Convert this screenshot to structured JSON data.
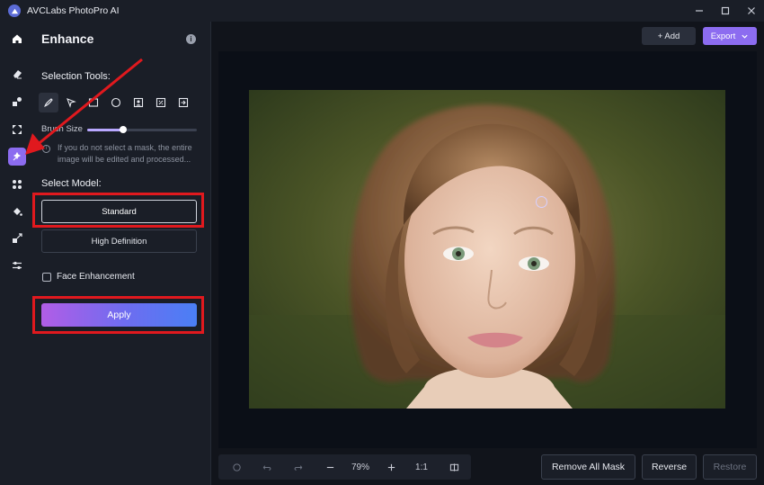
{
  "app": {
    "title": "AVCLabs PhotoPro AI",
    "window_controls": [
      "minimize",
      "maximize",
      "close"
    ]
  },
  "rail": {
    "items": [
      {
        "name": "home-icon"
      },
      {
        "name": "eraser-icon"
      },
      {
        "name": "replace-icon"
      },
      {
        "name": "scale-icon"
      },
      {
        "name": "enhance-icon",
        "active": true
      },
      {
        "name": "cutout-icon"
      },
      {
        "name": "fill-icon"
      },
      {
        "name": "resize-icon"
      },
      {
        "name": "adjust-icon"
      }
    ],
    "active_color": "#8c6cf0"
  },
  "panel": {
    "title": "Enhance",
    "selection_tools_label": "Selection Tools:",
    "tools": [
      "brush-icon",
      "lasso-icon",
      "rectangle-icon",
      "ellipse-icon",
      "portrait-icon",
      "auto-select-icon",
      "export-mask-icon"
    ],
    "brush_size_label": "Brush Size",
    "brush_size_fraction": 0.33,
    "note": "If you do not select a mask, the entire image will be edited and processed...",
    "select_model_label": "Select Model:",
    "models": [
      "Standard",
      "High Definition"
    ],
    "selected_model": "Standard",
    "face_enhancement_label": "Face Enhancement",
    "face_enhancement_checked": false,
    "apply_label": "Apply"
  },
  "toolbar": {
    "add_label": "+ Add",
    "export_label": "Export"
  },
  "bottom": {
    "zoom": "79%",
    "ratio_label": "1:1",
    "remove_all_mask_label": "Remove All Mask",
    "reverse_label": "Reverse",
    "restore_label": "Restore"
  },
  "colors": {
    "accent": "#8c6cf0",
    "annotation_red": "#e0191e",
    "background": "#11141b",
    "panel": "#1a1e27"
  }
}
